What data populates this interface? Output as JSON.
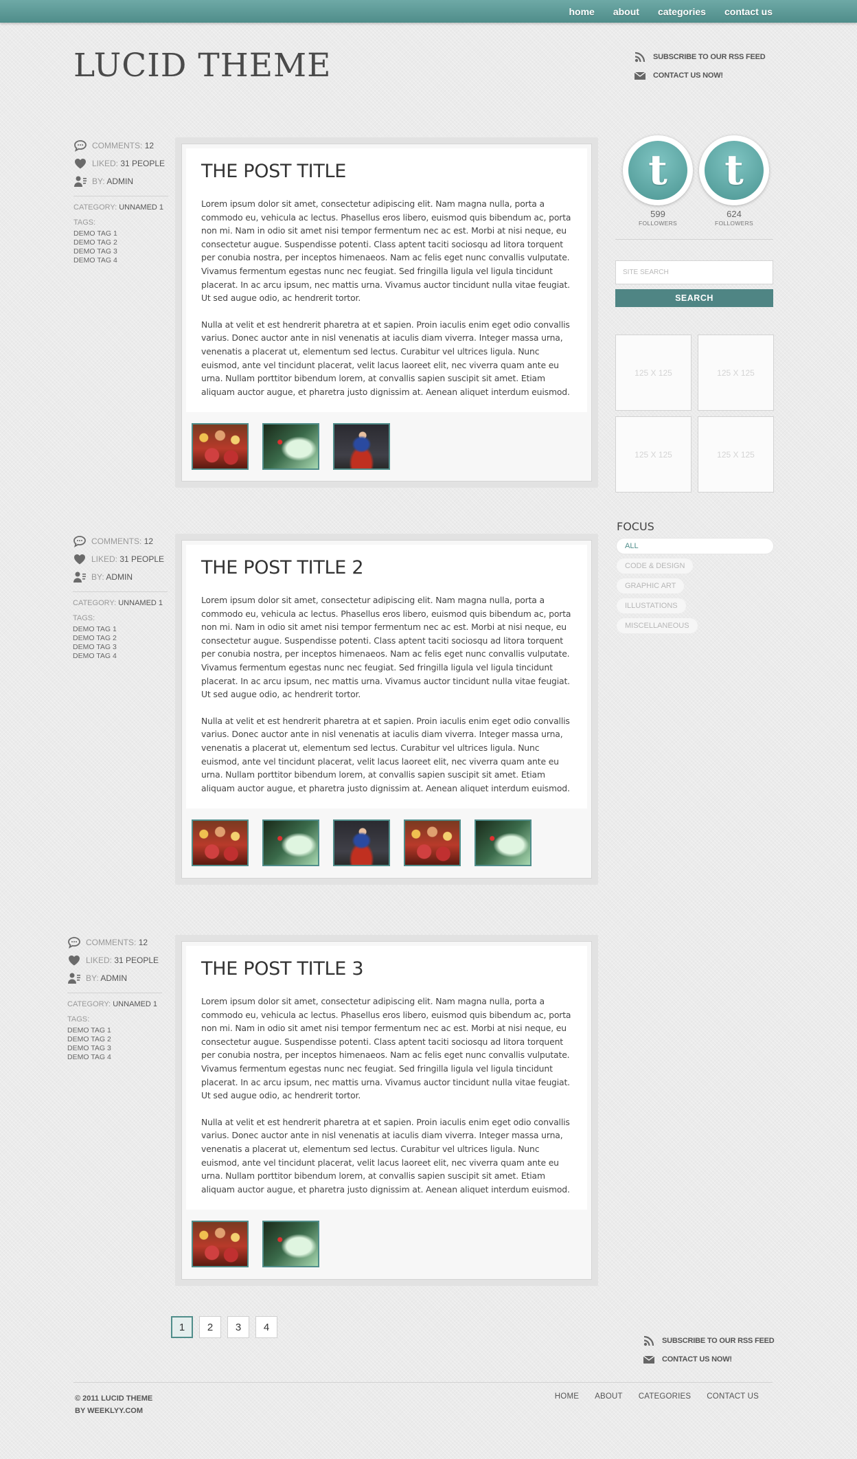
{
  "nav": {
    "items": [
      {
        "label": "home"
      },
      {
        "label": "about"
      },
      {
        "label": "categories"
      },
      {
        "label": "contact us"
      }
    ]
  },
  "brand": {
    "logo": "LUCID THEME"
  },
  "header_links": {
    "rss": "SUBSCRIBE TO OUR RSS FEED",
    "contact": "CONTACT US NOW!"
  },
  "posts": [
    {
      "title": "THE POST TITLE",
      "comments_label": "COMMENTS:",
      "comments": "12",
      "liked_label": "LIKED:",
      "liked": "31 PEOPLE",
      "by_label": "BY:",
      "by": "ADMIN",
      "category_label": "CATEGORY:",
      "category": "UNNAMED 1",
      "tags_label": "TAGS:",
      "tags": [
        "DEMO TAG 1",
        "DEMO TAG 2",
        "DEMO TAG 3",
        "DEMO TAG 4"
      ],
      "p1": "Lorem ipsum dolor sit amet, consectetur adipiscing elit. Nam magna nulla, porta a commodo eu, vehicula ac lectus. Phasellus eros libero, euismod quis bibendum ac, porta non mi. Nam in odio sit amet nisi tempor fermentum nec ac est. Morbi at nisi neque, eu consectetur augue. Suspendisse potenti. Class aptent taciti sociosqu ad litora torquent per conubia nostra, per inceptos himenaeos. Nam ac felis eget nunc convallis vulputate. Vivamus fermentum egestas nunc nec feugiat. Sed fringilla ligula vel ligula tincidunt placerat. In ac arcu ipsum, nec mattis urna. Vivamus auctor tincidunt nulla vitae feugiat. Ut sed augue odio, ac hendrerit tortor.",
      "p2": "Nulla at velit et est hendrerit pharetra at et sapien. Proin iaculis enim eget odio convallis varius. Donec auctor ante in nisl venenatis at iaculis diam viverra. Integer massa urna, venenatis a placerat ut, elementum sed lectus. Curabitur vel ultrices ligula. Nunc euismod, ante vel tincidunt placerat, velit lacus laoreet elit, nec viverra quam ante eu urna. Nullam porttitor bibendum lorem, at convallis sapien suscipit sit amet. Etiam aliquam auctor augue, et pharetra justo dignissim at. Aenean aliquet interdum euismod.",
      "thumbs": [
        "crowd",
        "green",
        "jump"
      ]
    },
    {
      "title": "THE POST TITLE 2",
      "comments_label": "COMMENTS:",
      "comments": "12",
      "liked_label": "LIKED:",
      "liked": "31 PEOPLE",
      "by_label": "BY:",
      "by": "ADMIN",
      "category_label": "CATEGORY:",
      "category": "UNNAMED 1",
      "tags_label": "TAGS:",
      "tags": [
        "DEMO TAG 1",
        "DEMO TAG 2",
        "DEMO TAG 3",
        "DEMO TAG 4"
      ],
      "p1": "Lorem ipsum dolor sit amet, consectetur adipiscing elit. Nam magna nulla, porta a commodo eu, vehicula ac lectus. Phasellus eros libero, euismod quis bibendum ac, porta non mi. Nam in odio sit amet nisi tempor fermentum nec ac est. Morbi at nisi neque, eu consectetur augue. Suspendisse potenti. Class aptent taciti sociosqu ad litora torquent per conubia nostra, per inceptos himenaeos. Nam ac felis eget nunc convallis vulputate. Vivamus fermentum egestas nunc nec feugiat. Sed fringilla ligula vel ligula tincidunt placerat. In ac arcu ipsum, nec mattis urna. Vivamus auctor tincidunt nulla vitae feugiat. Ut sed augue odio, ac hendrerit tortor.",
      "p2": "Nulla at velit et est hendrerit pharetra at et sapien. Proin iaculis enim eget odio convallis varius. Donec auctor ante in nisl venenatis at iaculis diam viverra. Integer massa urna, venenatis a placerat ut, elementum sed lectus. Curabitur vel ultrices ligula. Nunc euismod, ante vel tincidunt placerat, velit lacus laoreet elit, nec viverra quam ante eu urna. Nullam porttitor bibendum lorem, at convallis sapien suscipit sit amet. Etiam aliquam auctor augue, et pharetra justo dignissim at. Aenean aliquet interdum euismod.",
      "thumbs": [
        "crowd",
        "green",
        "jump",
        "crowd",
        "green"
      ]
    },
    {
      "title": "THE POST TITLE 3",
      "comments_label": "COMMENTS:",
      "comments": "12",
      "liked_label": "LIKED:",
      "liked": "31 PEOPLE",
      "by_label": "BY:",
      "by": "ADMIN",
      "category_label": "CATEGORY:",
      "category": "UNNAMED 1",
      "tags_label": "TAGS:",
      "tags": [
        "DEMO TAG 1",
        "DEMO TAG 2",
        "DEMO TAG 3",
        "DEMO TAG 4"
      ],
      "p1": "Lorem ipsum dolor sit amet, consectetur adipiscing elit. Nam magna nulla, porta a commodo eu, vehicula ac lectus. Phasellus eros libero, euismod quis bibendum ac, porta non mi. Nam in odio sit amet nisi tempor fermentum nec ac est. Morbi at nisi neque, eu consectetur augue. Suspendisse potenti. Class aptent taciti sociosqu ad litora torquent per conubia nostra, per inceptos himenaeos. Nam ac felis eget nunc convallis vulputate. Vivamus fermentum egestas nunc nec feugiat. Sed fringilla ligula vel ligula tincidunt placerat. In ac arcu ipsum, nec mattis urna. Vivamus auctor tincidunt nulla vitae feugiat. Ut sed augue odio, ac hendrerit tortor.",
      "p2": "Nulla at velit et est hendrerit pharetra at et sapien. Proin iaculis enim eget odio convallis varius. Donec auctor ante in nisl venenatis at iaculis diam viverra. Integer massa urna, venenatis a placerat ut, elementum sed lectus. Curabitur vel ultrices ligula. Nunc euismod, ante vel tincidunt placerat, velit lacus laoreet elit, nec viverra quam ante eu urna. Nullam porttitor bibendum lorem, at convallis sapien suscipit sit amet. Etiam aliquam auctor augue, et pharetra justo dignissim at. Aenean aliquet interdum euismod.",
      "thumbs": [
        "crowd",
        "green"
      ]
    }
  ],
  "sidebar": {
    "social": [
      {
        "icon": "tumblr-icon",
        "glyph": "t",
        "count": "599",
        "label": "FOLLOWERS"
      },
      {
        "icon": "twitter-icon",
        "glyph": "t",
        "count": "624",
        "label": "FOLLOWERS"
      }
    ],
    "search": {
      "placeholder": "SITE SEARCH",
      "button": "SEARCH"
    },
    "ads": [
      "125 X 125",
      "125 X 125",
      "125 X 125",
      "125 X 125"
    ],
    "focus": {
      "title": "FOCUS",
      "items": [
        "ALL",
        "CODE & DESIGN",
        "GRAPHIC ART",
        "ILLUSTATIONS",
        "MISCELLANEOUS"
      ]
    }
  },
  "pagination": [
    "1",
    "2",
    "3",
    "4"
  ],
  "footer": {
    "copyright": "© 2011 LUCID THEME",
    "by": "BY WEEKLYY.COM",
    "nav": [
      "HOME",
      "ABOUT",
      "CATEGORIES",
      "CONTACT US"
    ]
  },
  "colors": {
    "accent": "#4f8d8a",
    "topbar": "#5f9b98",
    "button": "#4f8584"
  }
}
